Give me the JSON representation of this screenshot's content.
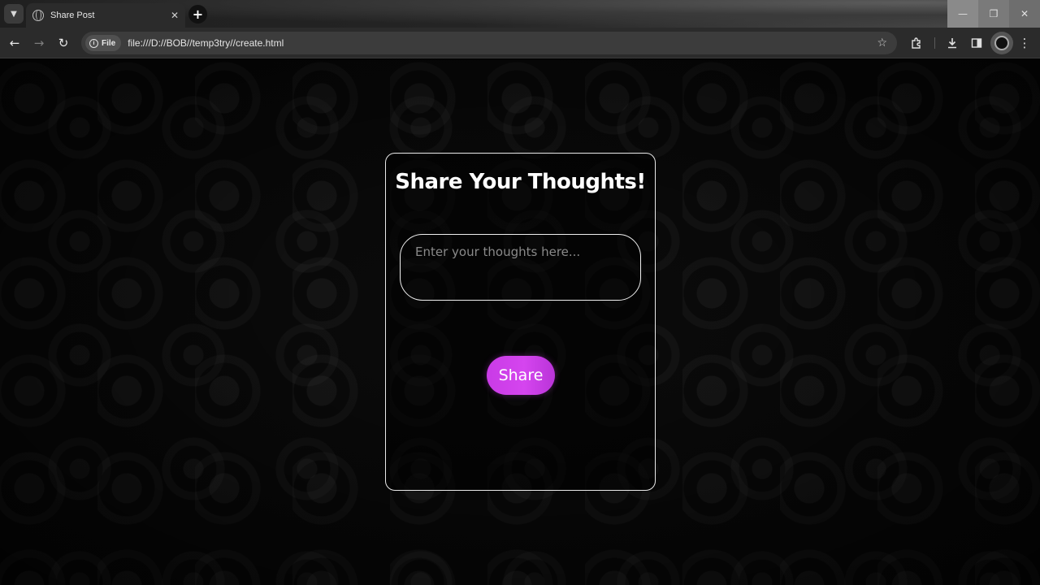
{
  "browser": {
    "tab": {
      "title": "Share Post",
      "close": "✕"
    },
    "new_tab": "+",
    "address": {
      "scheme_chip": "File",
      "url": "file:///D://BOB//temp3try//create.html"
    },
    "window_controls": {
      "minimize": "—",
      "maximize": "❐",
      "close": "✕"
    }
  },
  "page": {
    "title": "Share Your Thoughts!",
    "input": {
      "placeholder": "Enter your thoughts here...",
      "value": ""
    },
    "share_label": "Share"
  },
  "colors": {
    "accent": "#d545ef",
    "card_border": "#e9e9e9",
    "background": "#0b0b0b"
  }
}
